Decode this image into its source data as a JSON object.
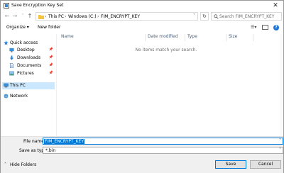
{
  "window": {
    "title": "Save Encryption Key Set",
    "close_glyph": "✕"
  },
  "address": {
    "breadcrumbs": [
      "This PC",
      "Windows (C:)",
      "FIM_ENCRYPT_KEY"
    ],
    "search_placeholder": "Search FIM_ENCRYPT_KEY"
  },
  "toolbar": {
    "organize_label": "Organize ▾",
    "new_folder_label": "New folder"
  },
  "nav_pane": {
    "quick_access": "Quick access",
    "items": [
      {
        "label": "Desktop",
        "pinned": true
      },
      {
        "label": "Downloads",
        "pinned": true
      },
      {
        "label": "Documents",
        "pinned": true
      },
      {
        "label": "Pictures",
        "pinned": true
      }
    ],
    "this_pc": "This PC",
    "network": "Network"
  },
  "file_list": {
    "columns": [
      "Name",
      "Date modified",
      "Type",
      "Size"
    ],
    "empty_message": "No items match your search."
  },
  "bottom": {
    "file_name_label": "File name:",
    "file_name_value": "FIM_ENCRYPT_KEY",
    "save_as_type_label": "Save as type:",
    "save_as_type_value": "*.bin",
    "hide_folders_label": "Hide Folders",
    "save_label": "Save",
    "cancel_label": "Cancel"
  },
  "colors": {
    "accent": "#0078d7",
    "selection": "#cce8ff",
    "folder": "#f5c242"
  }
}
